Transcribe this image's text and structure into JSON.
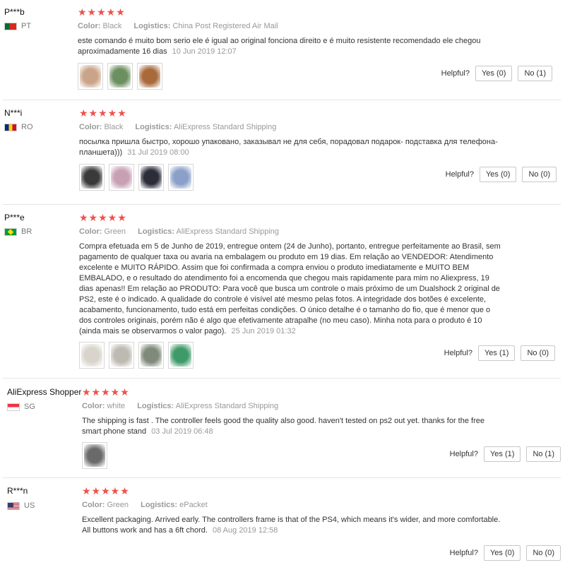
{
  "labels": {
    "color": "Color:",
    "logistics": "Logistics:",
    "helpful": "Helpful?",
    "stars": "★★★★★"
  },
  "reviews": [
    {
      "user": "P***b",
      "country": "PT",
      "flag": "portugal-flag-icon",
      "rating": 5,
      "color": "Black",
      "logistics": "China Post Registered Air Mail",
      "text": "este comando é muito bom serio ele é igual ao original fonciona direito e é muito resistente recomendado ele chegou aproximadamente 16 dias",
      "date": "10 Jun 2019 12:07",
      "photos": [
        "#c9a488",
        "#6b8f5e",
        "#a96a3b"
      ],
      "yes": "Yes (0)",
      "no": "No (1)"
    },
    {
      "user": "N***i",
      "country": "RO",
      "flag": "romania-flag-icon",
      "rating": 5,
      "color": "Black",
      "logistics": "AliExpress Standard Shipping",
      "text": "посылка пришла быстро, хорошо упаковано, заказывал не для себя, порадовал подарок- подставка для телефона-планшета)))",
      "date": "31 Jul 2019 08:00",
      "photos": [
        "#3a3a3a",
        "#c8a0b4",
        "#2d2d3a",
        "#8aa0c8"
      ],
      "yes": "Yes (0)",
      "no": "No (0)"
    },
    {
      "user": "P***e",
      "country": "BR",
      "flag": "brazil-flag-icon",
      "rating": 5,
      "color": "Green",
      "logistics": "AliExpress Standard Shipping",
      "text": "Compra efetuada em 5 de Junho de 2019, entregue ontem (24 de Junho), portanto, entregue perfeitamente ao Brasil, sem pagamento de qualquer taxa ou avaria na embalagem ou produto em 19 dias. Em relação ao VENDEDOR: Atendimento excelente e MUITO RÁPIDO. Assim que foi confirmada a compra enviou o produto imediatamente e MUITO BEM EMBALADO, e o resultado do atendimento foi a encomenda que chegou mais rapidamente para mim no Aliexpress, 19 dias apenas!! Em relação ao PRODUTO: Para você que busca um controle o mais próximo de um Dualshock 2 original de PS2, este é o indicado. A qualidade do controle é visível até mesmo pelas fotos. A integridade dos botões é excelente, acabamento, funcionamento, tudo está em perfeitas condições. O único detalhe é o tamanho do fio, que é menor que o dos controles originais, porém não é algo que efetivamente atrapalhe (no meu caso). Minha nota para o produto é 10 (ainda mais se observarmos o valor pago).",
      "date": "25 Jun 2019 01:32",
      "photos": [
        "#d8d4cc",
        "#bdbab2",
        "#7f8a7a",
        "#3f9a6a"
      ],
      "yes": "Yes (1)",
      "no": "No (0)"
    },
    {
      "user": "AliExpress Shopper",
      "country": "SG",
      "flag": "singapore-flag-icon",
      "rating": 5,
      "color": "white",
      "logistics": "AliExpress Standard Shipping",
      "text": "The shipping is fast . The controller feels good the quality also good. haven't tested on ps2 out yet. thanks for the free smart phone stand",
      "date": "03 Jul 2019 06:48",
      "photos": [
        "#6a6a6a"
      ],
      "yes": "Yes (1)",
      "no": "No (1)"
    },
    {
      "user": "R***n",
      "country": "US",
      "flag": "usa-flag-icon",
      "rating": 5,
      "color": "Green",
      "logistics": "ePacket",
      "text": "Excellent packaging. Arrived early. The controllers frame is that of the PS4, which means it's wider, and more comfortable. All buttons work and has a 6ft chord.",
      "date": "08 Aug 2019 12:58",
      "photos": [],
      "yes": "Yes (0)",
      "no": "No (0)"
    }
  ]
}
